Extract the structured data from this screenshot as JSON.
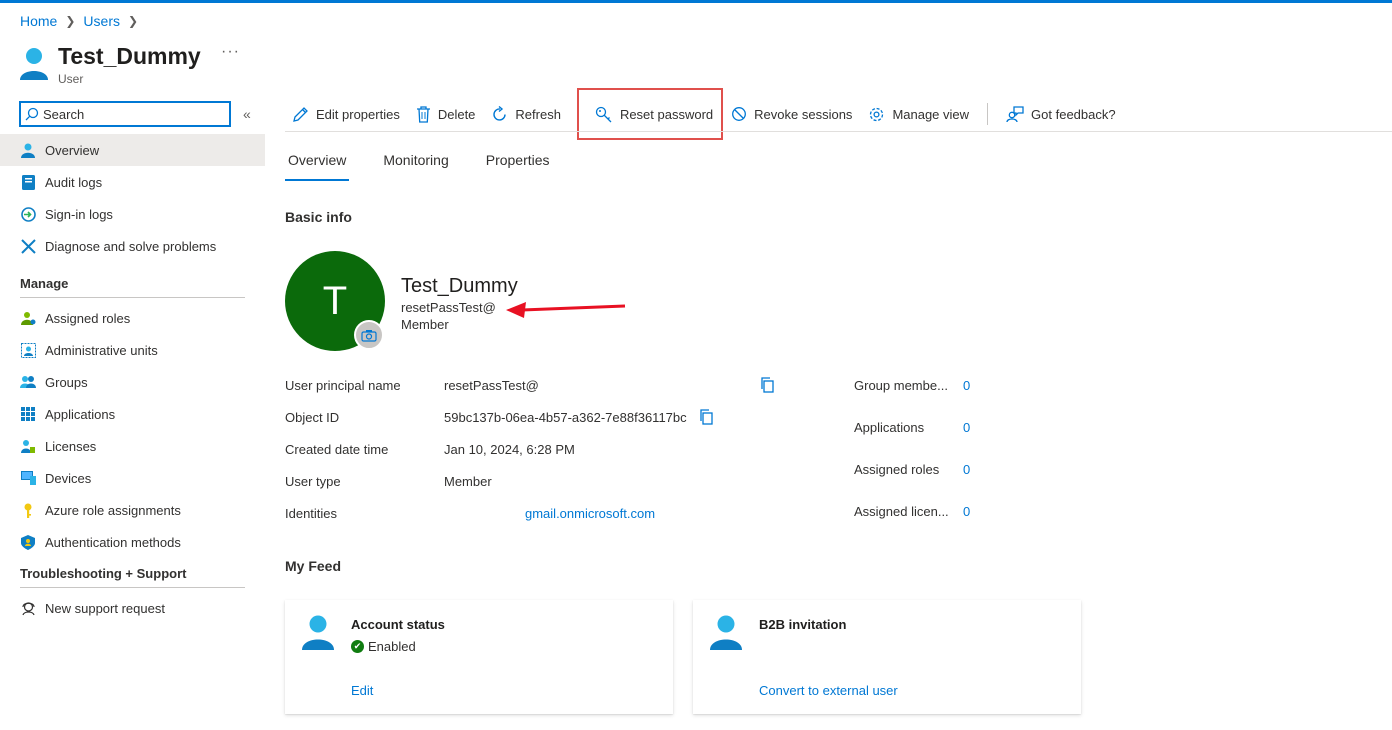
{
  "breadcrumb": {
    "home": "Home",
    "users": "Users"
  },
  "header": {
    "title": "Test_Dummy",
    "subtitle": "User",
    "more": "···"
  },
  "search": {
    "placeholder": "Search"
  },
  "nav": {
    "collapse": "«",
    "items": [
      {
        "label": "Overview",
        "icon": "user-icon"
      },
      {
        "label": "Audit logs",
        "icon": "audit-log-icon"
      },
      {
        "label": "Sign-in logs",
        "icon": "sign-in-icon"
      },
      {
        "label": "Diagnose and solve problems",
        "icon": "wrench-icon"
      }
    ],
    "manage_title": "Manage",
    "manage_items": [
      {
        "label": "Assigned roles",
        "icon": "roles-icon"
      },
      {
        "label": "Administrative units",
        "icon": "admin-units-icon"
      },
      {
        "label": "Groups",
        "icon": "groups-icon"
      },
      {
        "label": "Applications",
        "icon": "apps-grid-icon"
      },
      {
        "label": "Licenses",
        "icon": "license-icon"
      },
      {
        "label": "Devices",
        "icon": "device-icon"
      },
      {
        "label": "Azure role assignments",
        "icon": "key-icon"
      },
      {
        "label": "Authentication methods",
        "icon": "shield-icon"
      }
    ],
    "support_title": "Troubleshooting + Support",
    "support_items": [
      {
        "label": "New support request",
        "icon": "support-icon"
      }
    ]
  },
  "toolbar": {
    "edit": "Edit properties",
    "delete": "Delete",
    "refresh": "Refresh",
    "reset_password": "Reset password",
    "revoke": "Revoke sessions",
    "manage_view": "Manage view",
    "feedback": "Got feedback?"
  },
  "tabs": [
    "Overview",
    "Monitoring",
    "Properties"
  ],
  "basic_info": {
    "title": "Basic info",
    "avatar_letter": "T",
    "name": "Test_Dummy",
    "upn": "resetPassTest@",
    "user_type": "Member"
  },
  "properties": [
    {
      "label": "User principal name",
      "value": "resetPassTest@"
    },
    {
      "label": "Object ID",
      "value": "59bc137b-06ea-4b57-a362-7e88f36117bc"
    },
    {
      "label": "Created date time",
      "value": "Jan 10, 2024, 6:28 PM"
    },
    {
      "label": "User type",
      "value": "Member"
    },
    {
      "label": "Identities",
      "value": "gmail.onmicrosoft.com"
    }
  ],
  "stats": [
    {
      "label": "Group membe...",
      "value": "0"
    },
    {
      "label": "Applications",
      "value": "0"
    },
    {
      "label": "Assigned roles",
      "value": "0"
    },
    {
      "label": "Assigned licen...",
      "value": "0"
    }
  ],
  "feed": {
    "title": "My Feed",
    "cards": [
      {
        "title": "Account status",
        "status": "Enabled",
        "link": "Edit"
      },
      {
        "title": "B2B invitation",
        "status": "",
        "link": "Convert to external user"
      }
    ]
  },
  "colors": {
    "accent": "#0078d4",
    "avatar": "#0b6a0b",
    "highlight": "#e0504c",
    "arrow": "#e81123"
  }
}
